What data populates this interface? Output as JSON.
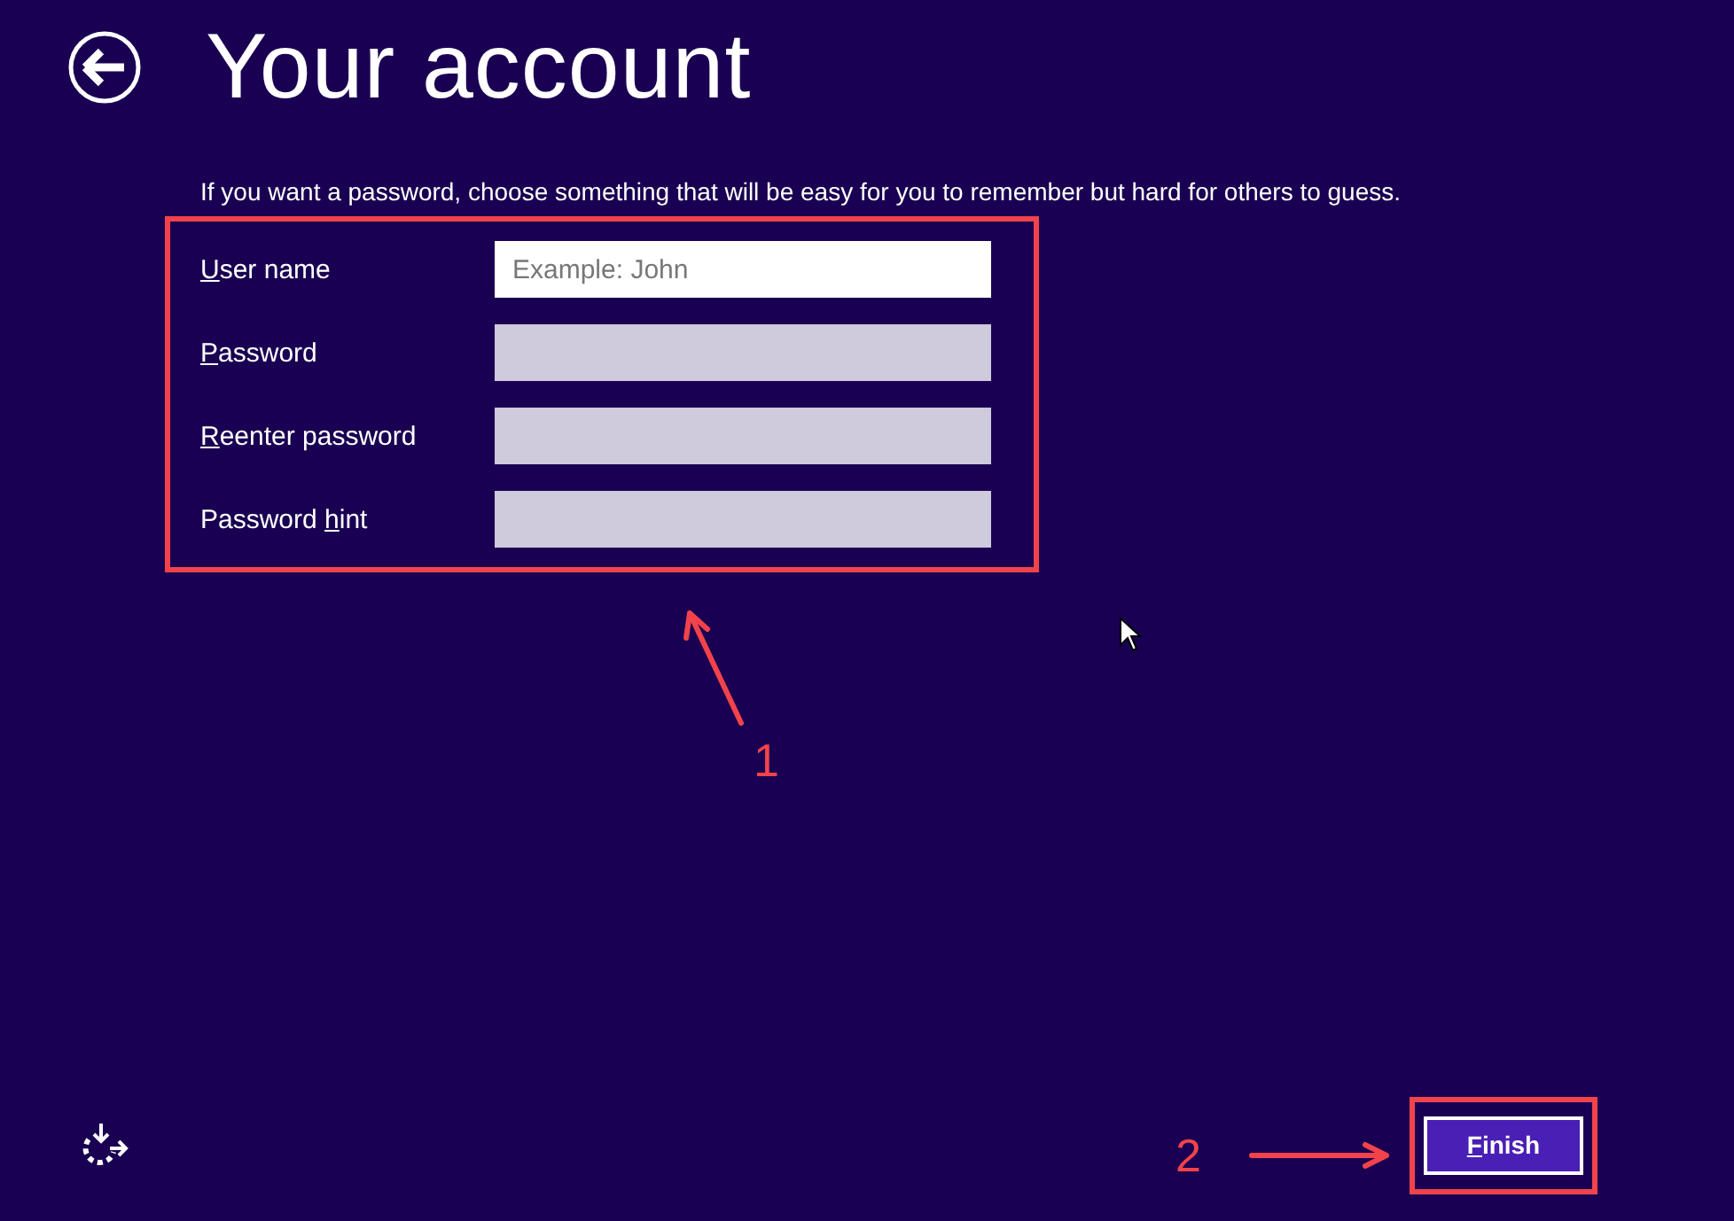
{
  "header": {
    "title": "Your account"
  },
  "intro": "If you want a password, choose something that will be easy for you to remember but hard for others to guess.",
  "fields": [
    {
      "label": {
        "key": "U",
        "post": "ser name"
      },
      "placeholder": "Example: John",
      "focused": true
    },
    {
      "label": {
        "key": "P",
        "post": "assword"
      },
      "focused": false
    },
    {
      "label": {
        "key": "R",
        "post": "eenter password"
      },
      "focused": false
    },
    {
      "label": {
        "pre": "Password ",
        "key": "h",
        "post": "int"
      },
      "focused": false
    }
  ],
  "finish_button": {
    "label": {
      "key": "F",
      "post": "inish"
    }
  },
  "annotations": [
    {
      "kind": "arrow-up",
      "label": "1"
    },
    {
      "kind": "arrow-right",
      "label": "2"
    }
  ]
}
